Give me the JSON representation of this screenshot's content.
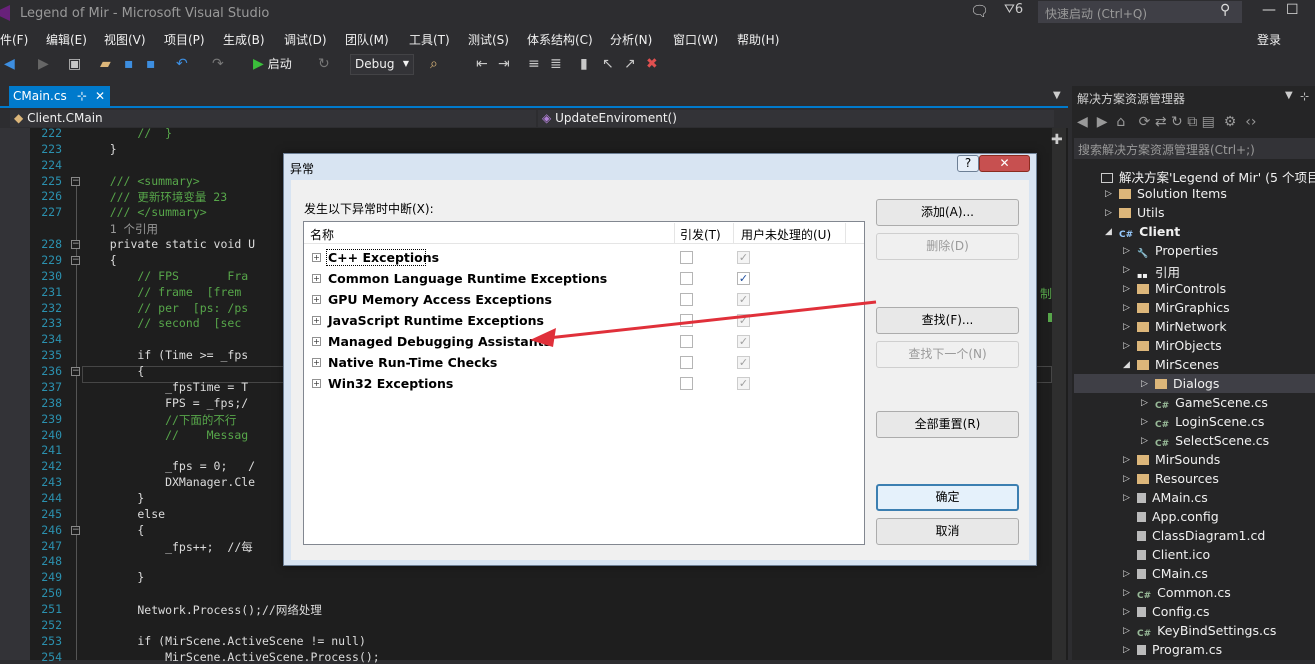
{
  "window": {
    "title": "Legend of Mir - Microsoft Visual Studio",
    "notif_count": "6",
    "quick_launch_placeholder": "快速启动 (Ctrl+Q)",
    "login": "登录"
  },
  "menu": [
    "件(F)",
    "编辑(E)",
    "视图(V)",
    "项目(P)",
    "生成(B)",
    "调试(D)",
    "团队(M)",
    "工具(T)",
    "测试(S)",
    "体系结构(C)",
    "分析(N)",
    "窗口(W)",
    "帮助(H)"
  ],
  "toolbar": {
    "start": "启动",
    "config": "Debug"
  },
  "tabs": {
    "active": "CMain.cs",
    "pin": "⊹",
    "close": "✕"
  },
  "nav": {
    "class": "Client.CMain",
    "member": "UpdateEnviroment()"
  },
  "code": {
    "lines": [
      {
        "n": "222",
        "t": "        //  }"
      },
      {
        "n": "223",
        "t": "    }"
      },
      {
        "n": "224",
        "t": ""
      },
      {
        "n": "225",
        "t": "    /// <summary>"
      },
      {
        "n": "226",
        "t": "    /// 更新环境变量 23"
      },
      {
        "n": "227",
        "t": "    /// </summary>"
      },
      {
        "n": "",
        "t": "    1 个引用"
      },
      {
        "n": "228",
        "t": "    private static void U"
      },
      {
        "n": "229",
        "t": "    {"
      },
      {
        "n": "230",
        "t": "        // FPS       Fra"
      },
      {
        "n": "231",
        "t": "        // frame  [frem"
      },
      {
        "n": "232",
        "t": "        // per  [ps: /ps"
      },
      {
        "n": "233",
        "t": "        // second  [sec"
      },
      {
        "n": "234",
        "t": ""
      },
      {
        "n": "235",
        "t": "        if (Time >= _fps"
      },
      {
        "n": "236",
        "t": "        {"
      },
      {
        "n": "237",
        "t": "            _fpsTime = T"
      },
      {
        "n": "238",
        "t": "            FPS = _fps;/"
      },
      {
        "n": "239",
        "t": "            //下面的不行"
      },
      {
        "n": "240",
        "t": "            //    Messag"
      },
      {
        "n": "241",
        "t": ""
      },
      {
        "n": "242",
        "t": "            _fps = 0;   /"
      },
      {
        "n": "243",
        "t": "            DXManager.Cle"
      },
      {
        "n": "244",
        "t": "        }"
      },
      {
        "n": "245",
        "t": "        else"
      },
      {
        "n": "246",
        "t": "        {"
      },
      {
        "n": "247",
        "t": "            _fps++;  //每"
      },
      {
        "n": "248",
        "t": ""
      },
      {
        "n": "249",
        "t": "        }"
      },
      {
        "n": "250",
        "t": ""
      },
      {
        "n": "251",
        "t": "        Network.Process();//网络处理"
      },
      {
        "n": "252",
        "t": ""
      },
      {
        "n": "253",
        "t": "        if (MirScene.ActiveScene != null)"
      },
      {
        "n": "254",
        "t": "            MirScene.ActiveScene.Process();"
      }
    ],
    "side_text": "制"
  },
  "solution_explorer": {
    "title": "解决方案资源管理器",
    "search_placeholder": "搜索解决方案资源管理器(Ctrl+;)",
    "items": [
      {
        "label": "解决方案'Legend of Mir' (5 个项目)",
        "indent": 0,
        "icon": "solution",
        "arrow": ""
      },
      {
        "label": "Solution Items",
        "indent": 1,
        "icon": "folder",
        "arrow": "▷"
      },
      {
        "label": "Utils",
        "indent": 1,
        "icon": "folder",
        "arrow": "▷"
      },
      {
        "label": "Client",
        "indent": 1,
        "icon": "project",
        "arrow": "◢",
        "bold": true
      },
      {
        "label": "Properties",
        "indent": 2,
        "icon": "props",
        "arrow": "▷"
      },
      {
        "label": "引用",
        "indent": 2,
        "icon": "ref",
        "arrow": "▷"
      },
      {
        "label": "MirControls",
        "indent": 2,
        "icon": "folder",
        "arrow": "▷"
      },
      {
        "label": "MirGraphics",
        "indent": 2,
        "icon": "folder",
        "arrow": "▷"
      },
      {
        "label": "MirNetwork",
        "indent": 2,
        "icon": "folder",
        "arrow": "▷"
      },
      {
        "label": "MirObjects",
        "indent": 2,
        "icon": "folder",
        "arrow": "▷"
      },
      {
        "label": "MirScenes",
        "indent": 2,
        "icon": "folder",
        "arrow": "◢"
      },
      {
        "label": "Dialogs",
        "indent": 3,
        "icon": "folder",
        "arrow": "▷",
        "selected": true
      },
      {
        "label": "GameScene.cs",
        "indent": 3,
        "icon": "cs",
        "arrow": "▷"
      },
      {
        "label": "LoginScene.cs",
        "indent": 3,
        "icon": "cs",
        "arrow": "▷"
      },
      {
        "label": "SelectScene.cs",
        "indent": 3,
        "icon": "cs",
        "arrow": "▷"
      },
      {
        "label": "MirSounds",
        "indent": 2,
        "icon": "folder",
        "arrow": "▷"
      },
      {
        "label": "Resources",
        "indent": 2,
        "icon": "folder",
        "arrow": "▷"
      },
      {
        "label": "AMain.cs",
        "indent": 2,
        "icon": "file",
        "arrow": "▷"
      },
      {
        "label": "App.config",
        "indent": 2,
        "icon": "file",
        "arrow": ""
      },
      {
        "label": "ClassDiagram1.cd",
        "indent": 2,
        "icon": "file",
        "arrow": ""
      },
      {
        "label": "Client.ico",
        "indent": 2,
        "icon": "file",
        "arrow": ""
      },
      {
        "label": "CMain.cs",
        "indent": 2,
        "icon": "file",
        "arrow": "▷"
      },
      {
        "label": "Common.cs",
        "indent": 2,
        "icon": "cs",
        "arrow": "▷"
      },
      {
        "label": "Config.cs",
        "indent": 2,
        "icon": "file",
        "arrow": "▷"
      },
      {
        "label": "KeyBindSettings.cs",
        "indent": 2,
        "icon": "cs",
        "arrow": "▷"
      },
      {
        "label": "Program.cs",
        "indent": 2,
        "icon": "file",
        "arrow": "▷"
      }
    ]
  },
  "dialog": {
    "title": "异常",
    "help": "?",
    "close": "✕",
    "label": "发生以下异常时中断(X):",
    "headers": {
      "name": "名称",
      "thrown": "引发(T)",
      "unhandled": "用户未处理的(U)"
    },
    "rows": [
      {
        "name": "C++ Exceptions",
        "thrown": "",
        "unhandled": "✓"
      },
      {
        "name": "Common Language Runtime Exceptions",
        "thrown": "",
        "unhandled": "✓"
      },
      {
        "name": "GPU Memory Access Exceptions",
        "thrown": "",
        "unhandled": "✓"
      },
      {
        "name": "JavaScript Runtime Exceptions",
        "thrown": "",
        "unhandled": "✓"
      },
      {
        "name": "Managed Debugging Assistants",
        "thrown": "",
        "unhandled": "✓"
      },
      {
        "name": "Native Run-Time Checks",
        "thrown": "",
        "unhandled": "✓"
      },
      {
        "name": "Win32 Exceptions",
        "thrown": "",
        "unhandled": "✓"
      }
    ],
    "buttons": {
      "add": "添加(A)...",
      "delete": "删除(D)",
      "find": "查找(F)...",
      "find_next": "查找下一个(N)",
      "reset_all": "全部重置(R)",
      "ok": "确定",
      "cancel": "取消"
    }
  },
  "colors": {
    "accent": "#007acc",
    "arrow": "#e0303a"
  }
}
